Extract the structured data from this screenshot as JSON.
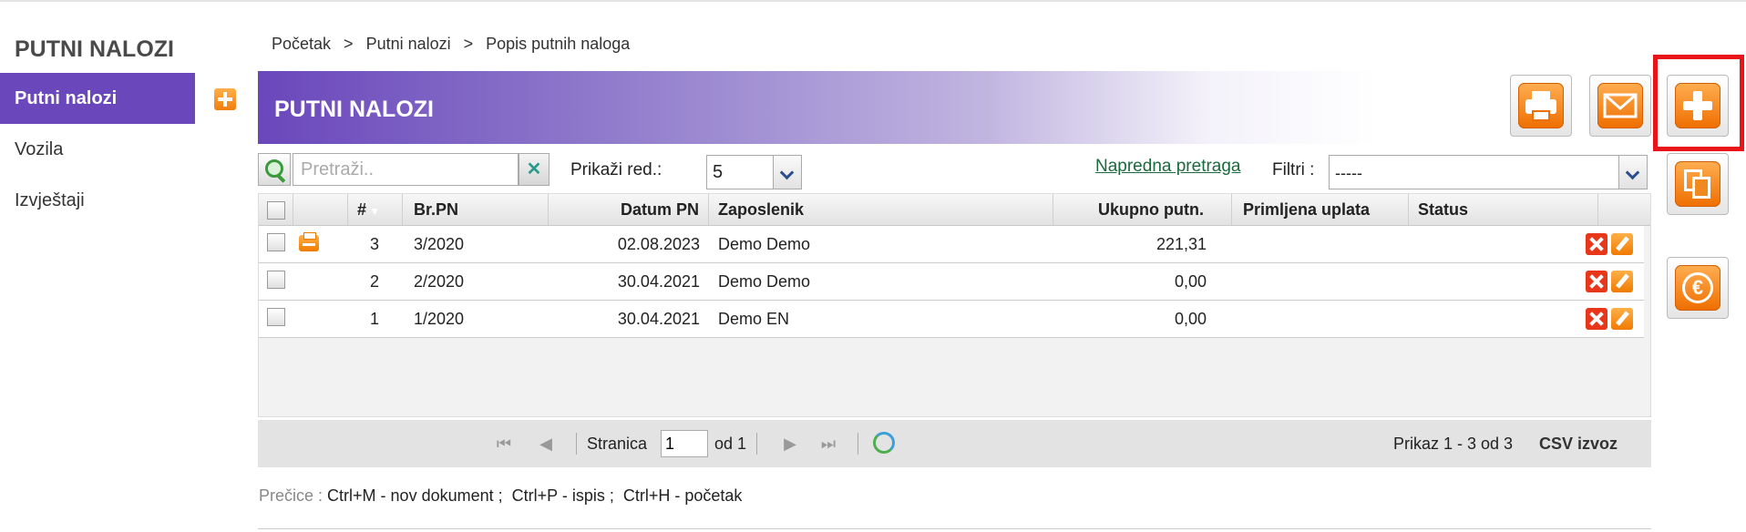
{
  "sidebar": {
    "title": "PUTNI NALOZI",
    "items": [
      {
        "label": "Putni nalozi",
        "active": true
      },
      {
        "label": "Vozila"
      },
      {
        "label": "Izvještaji"
      }
    ]
  },
  "breadcrumb": [
    "Početak",
    "Putni nalozi",
    "Popis putnih naloga"
  ],
  "breadcrumb_sep": ">",
  "header": {
    "title": "PUTNI NALOZI"
  },
  "toolbar": {
    "search_placeholder": "Pretraži..",
    "rows_label": "Prikaži red.:",
    "rows_value": "5",
    "advanced_search": "Napredna pretraga",
    "filter_label": "Filtri :",
    "filter_value": "-----"
  },
  "table": {
    "columns": [
      "#",
      "Br.PN",
      "Datum PN",
      "Zaposlenik",
      "Ukupno putn.",
      "Primljena uplata",
      "Status"
    ],
    "rows": [
      {
        "num": "3",
        "br": "3/2020",
        "datum": "02.08.2023",
        "zaposlenik": "Demo Demo",
        "ukupno": "221,31",
        "uplata": "",
        "status": "",
        "printed": true
      },
      {
        "num": "2",
        "br": "2/2020",
        "datum": "30.04.2021",
        "zaposlenik": "Demo Demo",
        "ukupno": "0,00",
        "uplata": "",
        "status": ""
      },
      {
        "num": "1",
        "br": "1/2020",
        "datum": "30.04.2021",
        "zaposlenik": "Demo EN",
        "ukupno": "0,00",
        "uplata": "",
        "status": ""
      }
    ]
  },
  "pager": {
    "page_label": "Stranica",
    "page_value": "1",
    "of_label": "od 1",
    "summary": "Prikaz 1 - 3 od 3",
    "csv_label": "CSV izvoz"
  },
  "shortcuts": {
    "label": "Prečice :",
    "items": [
      "Ctrl+M - nov dokument ;",
      "Ctrl+P - ispis ;",
      "Ctrl+H - početak"
    ]
  },
  "colors": {
    "accent": "#6a47bb",
    "action_orange": "#f27d0c",
    "highlight_frame": "#e8141a"
  }
}
